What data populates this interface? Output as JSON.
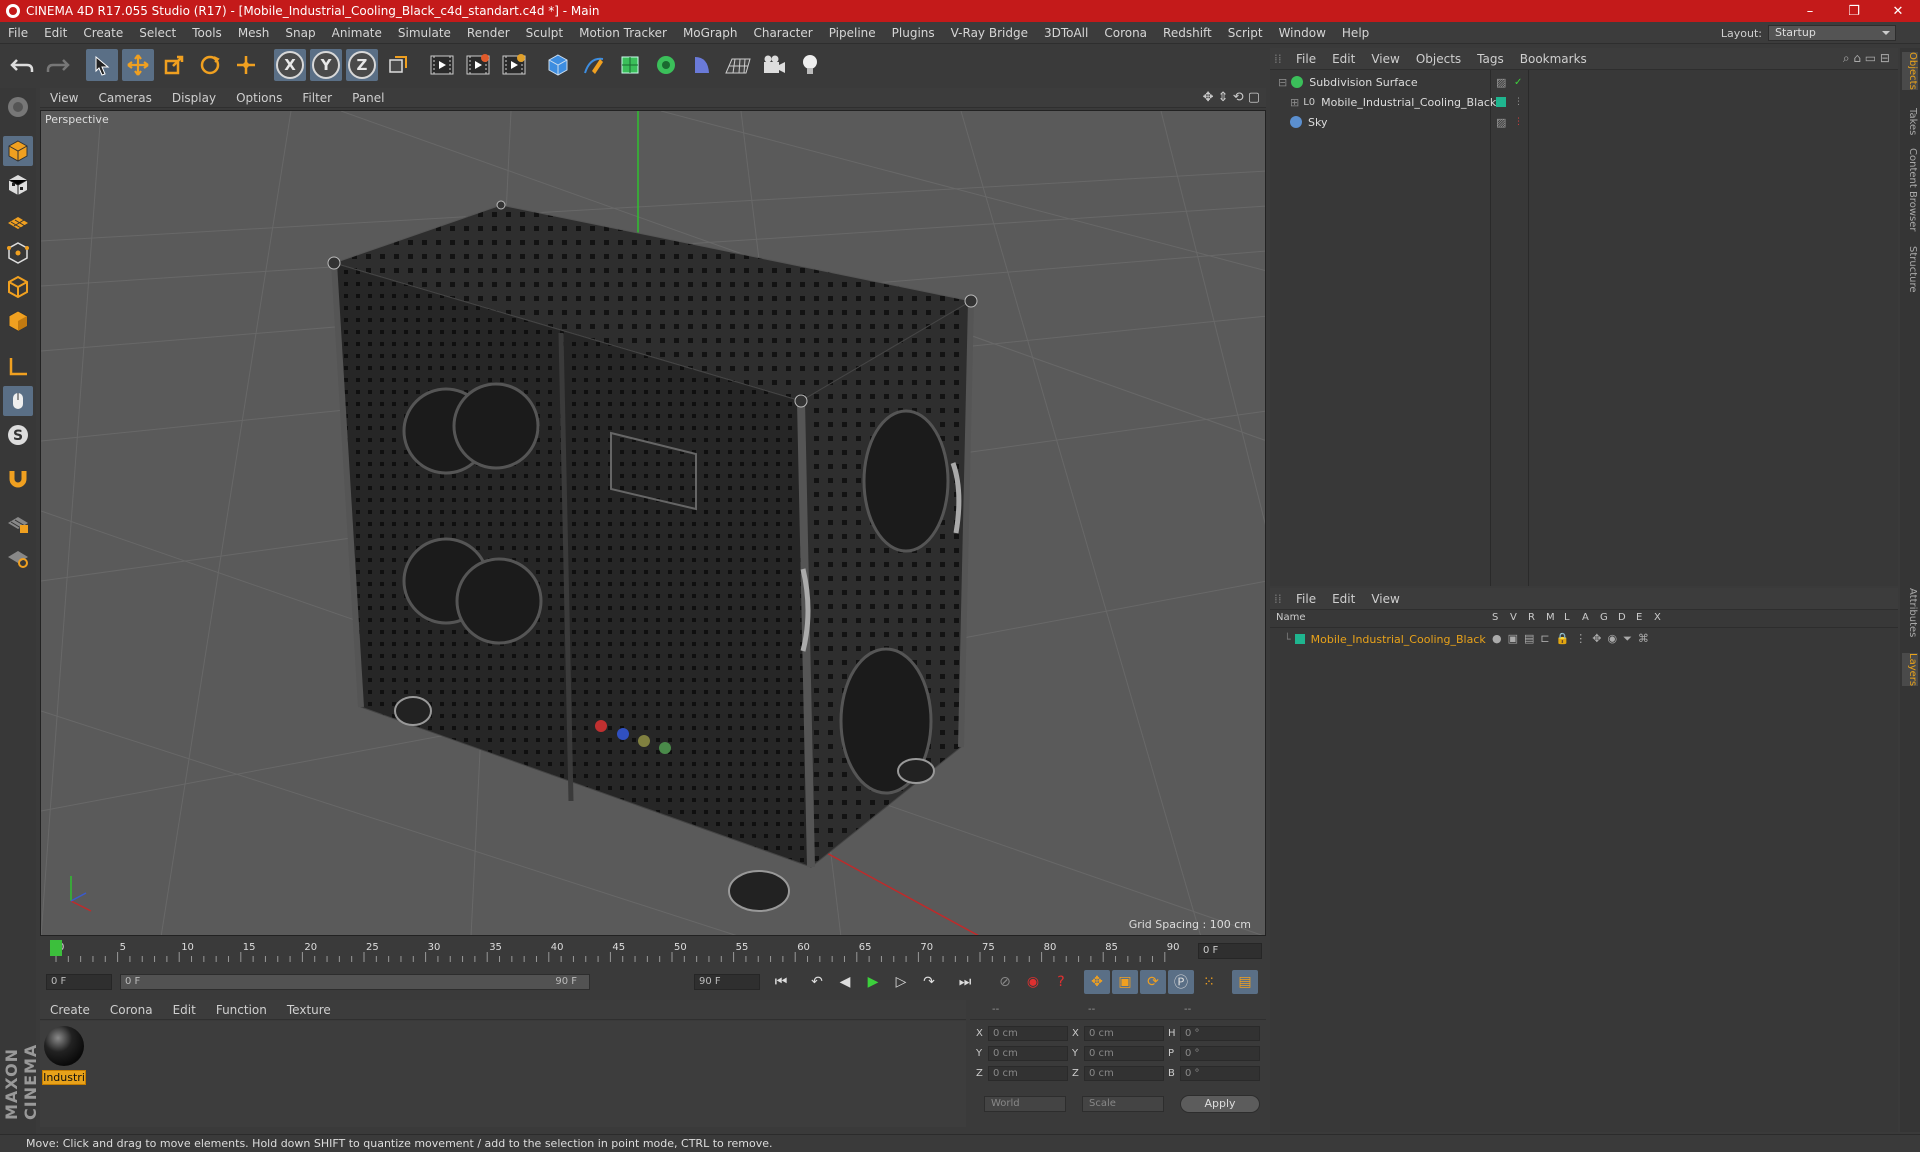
{
  "window": {
    "title": "CINEMA 4D R17.055 Studio (R17) - [Mobile_Industrial_Cooling_Black_c4d_standart.c4d *] - Main",
    "minimize": "–",
    "restore": "❐",
    "close": "✕"
  },
  "menubar": [
    "File",
    "Edit",
    "Create",
    "Select",
    "Tools",
    "Mesh",
    "Snap",
    "Animate",
    "Simulate",
    "Render",
    "Sculpt",
    "Motion Tracker",
    "MoGraph",
    "Character",
    "Pipeline",
    "Plugins",
    "V-Ray Bridge",
    "3DToAll",
    "Corona",
    "Redshift",
    "Script",
    "Window",
    "Help"
  ],
  "layout": {
    "label": "Layout:",
    "value": "Startup"
  },
  "viewport": {
    "menu": [
      "View",
      "Cameras",
      "Display",
      "Options",
      "Filter",
      "Panel"
    ],
    "label": "Perspective",
    "grid_spacing": "Grid Spacing : 100 cm"
  },
  "timeline": {
    "ticks": [
      "0",
      "5",
      "10",
      "15",
      "20",
      "25",
      "30",
      "35",
      "40",
      "45",
      "50",
      "55",
      "60",
      "65",
      "70",
      "75",
      "80",
      "85",
      "90"
    ],
    "current_frame": "0 F"
  },
  "transport": {
    "start_field": "0 F",
    "range_start": "0 F",
    "range_end": "90 F",
    "end_field": "90 F"
  },
  "material_manager": {
    "menu": [
      "Create",
      "Corona",
      "Edit",
      "Function",
      "Texture"
    ],
    "material_name": "Industri"
  },
  "coordinates": {
    "headers": [
      "--",
      "--",
      "--"
    ],
    "rows": [
      {
        "a": "X",
        "av": "0 cm",
        "b": "X",
        "bv": "0 cm",
        "c": "H",
        "cv": "0 °"
      },
      {
        "a": "Y",
        "av": "0 cm",
        "b": "Y",
        "bv": "0 cm",
        "c": "P",
        "cv": "0 °"
      },
      {
        "a": "Z",
        "av": "0 cm",
        "b": "Z",
        "bv": "0 cm",
        "c": "B",
        "cv": "0 °"
      }
    ],
    "world": "World",
    "scale": "Scale",
    "apply": "Apply"
  },
  "object_manager": {
    "menu": [
      "File",
      "Edit",
      "View",
      "Objects",
      "Tags",
      "Bookmarks"
    ],
    "objects": [
      {
        "name": "Subdivision Surface"
      },
      {
        "name": "Mobile_Industrial_Cooling_Black"
      },
      {
        "name": "Sky"
      }
    ]
  },
  "layer_manager": {
    "menu": [
      "File",
      "Edit",
      "View"
    ],
    "columns": [
      "Name",
      "S",
      "V",
      "R",
      "M",
      "L",
      "A",
      "G",
      "D",
      "E",
      "X"
    ],
    "layers": [
      {
        "name": "Mobile_Industrial_Cooling_Black"
      }
    ]
  },
  "right_tabs": [
    "Objects",
    "Takes",
    "Content Browser",
    "Structure",
    "Attributes",
    "Layers"
  ],
  "maxon_logo": "MAXON CINEMA 4D",
  "status": "Move: Click and drag to move elements. Hold down SHIFT to quantize movement / add to the selection in point mode, CTRL to remove.",
  "colors": {
    "title_red": "#c41a1a",
    "accent_blue": "#5a6f86",
    "layer_green": "#1fb58f",
    "layer_orange": "#e8a21a"
  }
}
